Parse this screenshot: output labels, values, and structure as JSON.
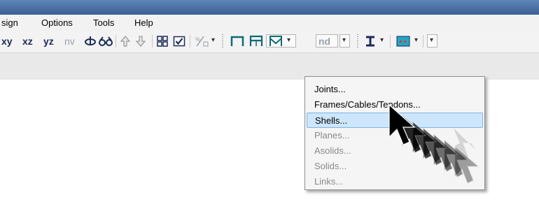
{
  "menubar": {
    "items": [
      {
        "label": "sign"
      },
      {
        "label": "Options"
      },
      {
        "label": "Tools"
      },
      {
        "label": "Help"
      }
    ]
  },
  "toolbar": {
    "views": [
      {
        "label": "xy"
      },
      {
        "label": "xz"
      },
      {
        "label": "yz"
      },
      {
        "label": "nv"
      }
    ],
    "nd_label": "nd",
    "icons": [
      "rotate-3d-icon",
      "glasses-icon",
      "arrow-up-icon",
      "arrow-down-icon",
      "grid-icon",
      "checkbox-icon",
      "fraction-icon",
      "frame-icon",
      "frame-cable-icon",
      "frame-tendon-icon",
      "i-beam-icon",
      "color-display-icon"
    ]
  },
  "dropdown": {
    "items": [
      {
        "label": "Joints...",
        "enabled": true
      },
      {
        "label": "Frames/Cables/Tendons...",
        "enabled": true
      },
      {
        "label": "Shells...",
        "enabled": true,
        "highlighted": true
      },
      {
        "label": "Planes...",
        "enabled": false
      },
      {
        "label": "Asolids...",
        "enabled": false
      },
      {
        "label": "Solids...",
        "enabled": true
      },
      {
        "label": "Links...",
        "enabled": false
      }
    ]
  },
  "colors": {
    "accent": "#cde6fb",
    "title_bar": "#4a6fa5",
    "frame_icon": "#0f6b74"
  }
}
